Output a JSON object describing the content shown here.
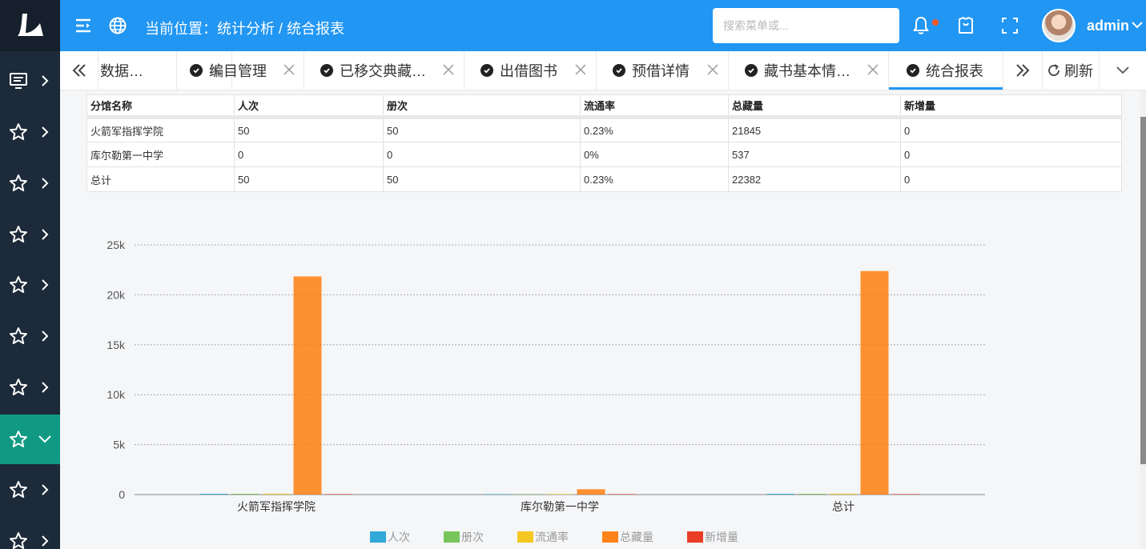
{
  "header": {
    "breadcrumb": "当前位置：统计分析 / 统合报表",
    "search_placeholder": "搜索菜单或...",
    "username": "admin"
  },
  "tabs": [
    {
      "label": "数据…",
      "active": false
    },
    {
      "label": "编目管理",
      "active": false
    },
    {
      "label": "已移交典藏…",
      "active": false
    },
    {
      "label": "出借图书",
      "active": false
    },
    {
      "label": "预借详情",
      "active": false
    },
    {
      "label": "藏书基本情…",
      "active": false
    },
    {
      "label": "统合报表",
      "active": true
    }
  ],
  "refresh_label": "刷新",
  "table": {
    "headers": [
      "分馆名称",
      "人次",
      "册次",
      "流通率",
      "总藏量",
      "新增量"
    ],
    "rows": [
      [
        "火箭军指挥学院",
        "50",
        "50",
        "0.23%",
        "21845",
        "0"
      ],
      [
        "库尔勒第一中学",
        "0",
        "0",
        "0%",
        "537",
        "0"
      ],
      [
        "总计",
        "50",
        "50",
        "0.23%",
        "22382",
        "0"
      ]
    ]
  },
  "chart_data": {
    "type": "bar",
    "categories": [
      "火箭军指挥学院",
      "库尔勒第一中学",
      "总计"
    ],
    "series": [
      {
        "name": "人次",
        "values": [
          50,
          0,
          50
        ],
        "color": "#1ba1d4"
      },
      {
        "name": "册次",
        "values": [
          50,
          0,
          50
        ],
        "color": "#6cc04a"
      },
      {
        "name": "流通率",
        "values": [
          0.23,
          0,
          0.23
        ],
        "color": "#f5c20b"
      },
      {
        "name": "总藏量",
        "values": [
          21845,
          537,
          22382
        ],
        "color": "#ff7800"
      },
      {
        "name": "新增量",
        "values": [
          0,
          0,
          0
        ],
        "color": "#e8290f"
      }
    ],
    "yticks": [
      "0",
      "5k",
      "10k",
      "15k",
      "20k",
      "25k"
    ],
    "ylim": [
      0,
      25000
    ],
    "grid": true,
    "legend": "bottom"
  },
  "colors": {
    "header_bg": "#2196f3",
    "sidebar_bg": "#1c2a3a",
    "sidebar_active": "#109a84",
    "tab_active_underline": "#2196f3"
  }
}
